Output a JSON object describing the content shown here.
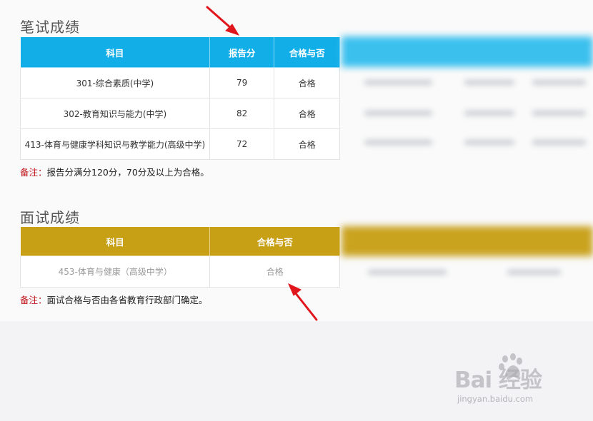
{
  "written": {
    "title": "笔试成绩",
    "headers": [
      "科目",
      "报告分",
      "合格与否"
    ],
    "rows": [
      {
        "subject": "301-综合素质(中学)",
        "score": "79",
        "result": "合格"
      },
      {
        "subject": "302-教育知识与能力(中学)",
        "score": "82",
        "result": "合格"
      },
      {
        "subject": "413-体育与健康学科知识与教学能力(高级中学)",
        "score": "72",
        "result": "合格"
      }
    ],
    "note_label": "备注：",
    "note_text": "报告分满分120分，70分及以上为合格。"
  },
  "interview": {
    "title": "面试成绩",
    "headers": [
      "科目",
      "合格与否"
    ],
    "rows": [
      {
        "subject": "453-体育与健康（高级中学）",
        "result": "合格"
      }
    ],
    "note_label": "备注：",
    "note_text": "面试合格与否由各省教育行政部门确定。"
  },
  "watermark": {
    "brand": "Bai  经验",
    "url": "jingyan.baidu.com"
  },
  "colors": {
    "written_header": "#12aee8",
    "interview_header": "#c8a016",
    "note_label": "#c0141c",
    "arrow": "#e0161c"
  },
  "icons": [
    "red-arrow-icon",
    "baidu-paw-icon"
  ]
}
